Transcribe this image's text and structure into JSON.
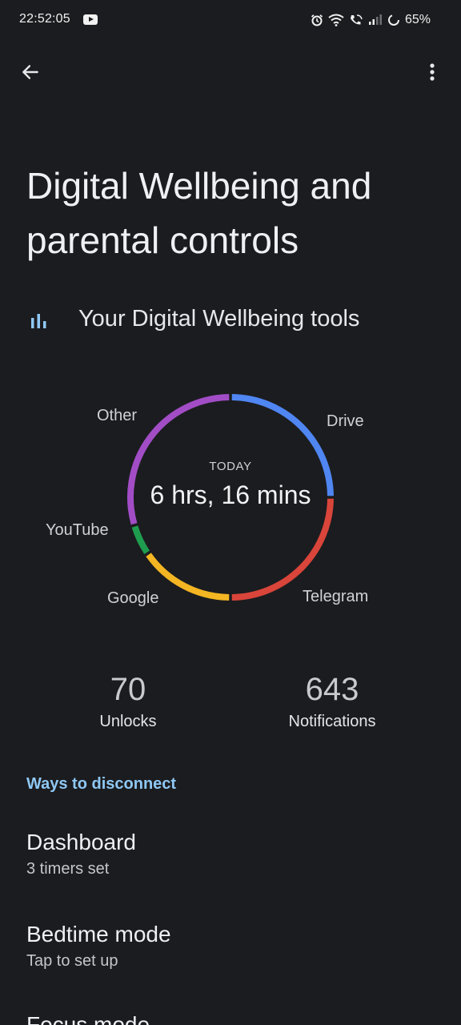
{
  "status_bar": {
    "time": "22:52:05",
    "battery": "65%"
  },
  "page": {
    "title_line1": "Digital Wellbeing and",
    "title_line2": "parental controls",
    "tools_label": "Your Digital Wellbeing tools"
  },
  "chart_data": {
    "type": "pie",
    "style": "donut",
    "center_caption": "TODAY",
    "center_value": "6 hrs, 16 mins",
    "categories": [
      "Drive",
      "Telegram",
      "Google",
      "YouTube",
      "Other"
    ],
    "values": [
      0.25,
      0.25,
      0.155,
      0.05,
      0.295
    ],
    "colors": [
      "#4f86f2",
      "#d9453a",
      "#f4b622",
      "#1f9d4e",
      "#a24dc6"
    ]
  },
  "stats": {
    "unlocks_value": "70",
    "unlocks_label": "Unlocks",
    "notifications_value": "643",
    "notifications_label": "Notifications"
  },
  "section": {
    "header": "Ways to disconnect"
  },
  "items": [
    {
      "title": "Dashboard",
      "subtitle": "3 timers set"
    },
    {
      "title": "Bedtime mode",
      "subtitle": "Tap to set up"
    },
    {
      "title": "Focus mode",
      "subtitle": ""
    }
  ],
  "colors": {
    "background": "#1b1c1f",
    "accent": "#8fc8f4"
  }
}
